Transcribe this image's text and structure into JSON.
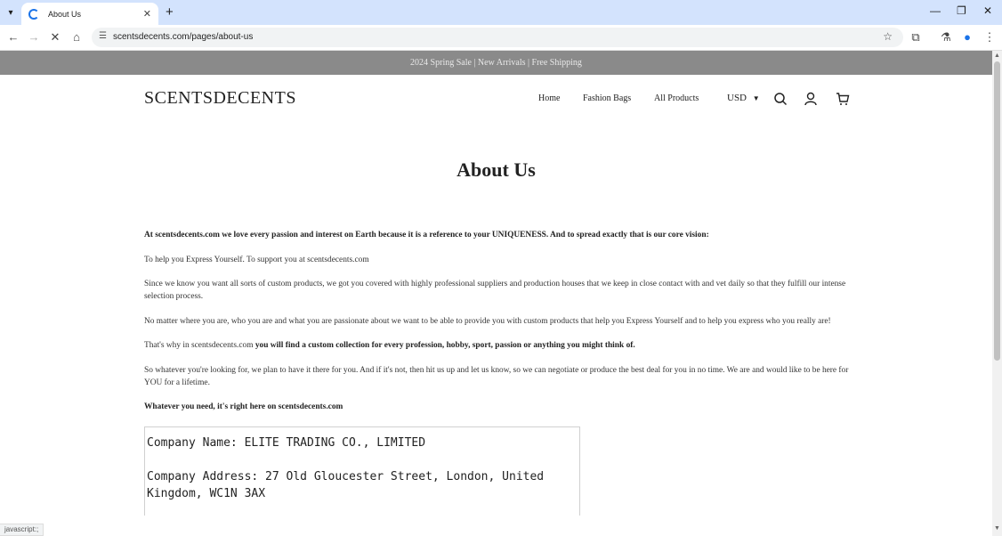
{
  "browser": {
    "tab_title": "About Us",
    "url": "scentsdecents.com/pages/about-us",
    "status_text": "javascript:;"
  },
  "site": {
    "announcement": "2024 Spring Sale | New Arrivals | Free Shipping",
    "logo": "SCENTSDECENTS",
    "nav": [
      "Home",
      "Fashion Bags",
      "All Products"
    ],
    "currency": "USD"
  },
  "page": {
    "title": "About Us",
    "p1": "At scentsdecents.com we love every passion and interest on Earth because it is a reference to your UNIQUENESS. And to spread exactly that is our core vision:",
    "p2": "To help you Express Yourself. To support you at scentsdecents.com",
    "p3": "Since we know you want all sorts of custom products, we got you covered with highly professional suppliers and production houses that we keep in close contact with and vet daily so that they fulfill our intense selection process.",
    "p4": "No matter where you are, who you are and what you are passionate about we want to be able to provide you with custom products that help you Express Yourself and to help you express who you really are!",
    "p5_prefix": "That's why in scentsdecents.com",
    "p5_bold": " you will find a custom collection for every profession, hobby, sport, passion or anything you might think of.",
    "p6": "So whatever you're looking for, we plan to have it there for you. And if it's not, then hit us up and let us know, so we can negotiate or produce the best deal for you in no time. We are and would like to be here for YOU for a lifetime.",
    "p7": "Whatever you need, it's right here on scentsdecents.com",
    "company_name": "Company Name: ELITE TRADING CO., LIMITED",
    "company_address": "Company Address: 27 Old Gloucester Street, London, United Kingdom, WC1N 3AX"
  }
}
